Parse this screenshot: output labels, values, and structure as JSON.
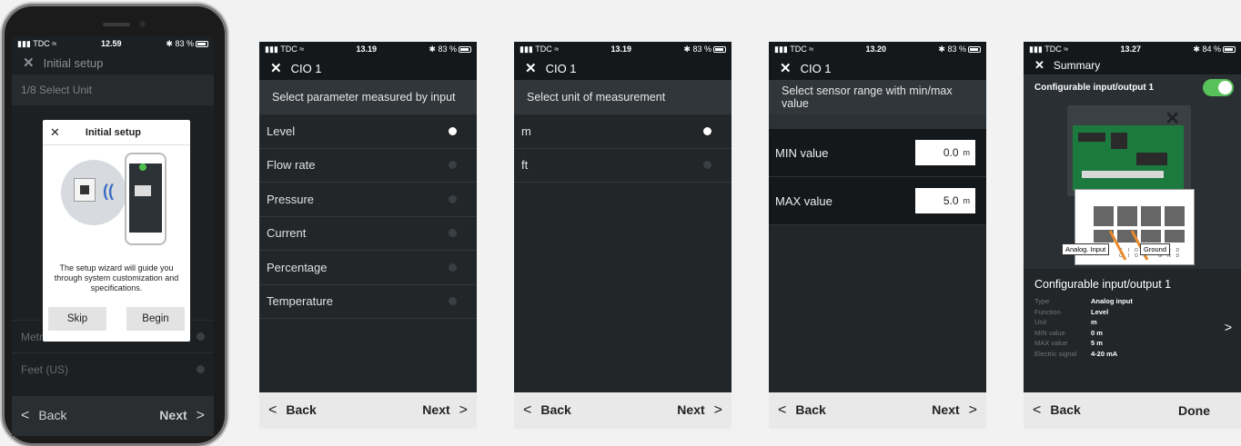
{
  "common": {
    "carrier": "TDC",
    "back_label": "Back",
    "next_label": "Next"
  },
  "screen1": {
    "time": "12.59",
    "battery": "83 %",
    "title": "Initial setup",
    "step": "1/8 Select Unit",
    "row_metric": "Metric",
    "row_feet": "Feet (US)",
    "dialog": {
      "title": "Initial setup",
      "text": "The setup wizard will guide you through system customization and specifications.",
      "skip": "Skip",
      "begin": "Begin"
    }
  },
  "screen2": {
    "time": "13.19",
    "battery": "83 %",
    "title": "CIO 1",
    "header": "Select parameter measured by input",
    "options": [
      "Level",
      "Flow rate",
      "Pressure",
      "Current",
      "Percentage",
      "Temperature"
    ],
    "selected_index": 0
  },
  "screen3": {
    "time": "13.19",
    "battery": "83 %",
    "title": "CIO 1",
    "header": "Select unit of measurement",
    "options": [
      "m",
      "ft"
    ],
    "selected_index": 0
  },
  "screen4": {
    "time": "13.20",
    "battery": "83 %",
    "title": "CIO 1",
    "header": "Select sensor range with min/max value",
    "min_label": "MIN value",
    "min_value": "0.0",
    "max_label": "MAX value",
    "max_value": "5.0",
    "unit": "m"
  },
  "screen5": {
    "time": "13.27",
    "battery": "84 %",
    "title": "Summary",
    "toggle_label": "Configurable input/output 1",
    "toggle_on": true,
    "callout_analog": "Analog. Input",
    "callout_ground": "Ground",
    "terminal_labels": "CIO1 GND CIO2 GND",
    "summary_title": "Configurable input/output 1",
    "rows": [
      {
        "k": "Type",
        "v": "Analog input"
      },
      {
        "k": "Function",
        "v": "Level"
      },
      {
        "k": "Unit",
        "v": "m"
      },
      {
        "k": "MIN value",
        "v": "0 m"
      },
      {
        "k": "MAX value",
        "v": "5 m"
      },
      {
        "k": "Electric signal",
        "v": "4-20 mA"
      }
    ],
    "done_label": "Done"
  },
  "colors": {
    "screen_bg": "#222629",
    "header_bg": "#31363a",
    "toggle_green": "#58c15a",
    "wire_orange": "#e88a2a",
    "bottom_bar": "#e9e9e9"
  }
}
